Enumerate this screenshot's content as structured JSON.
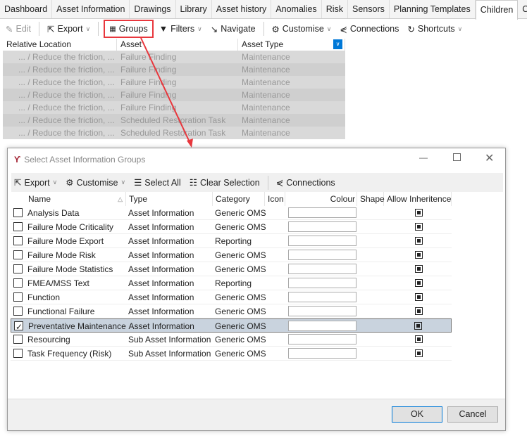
{
  "tabs": [
    "Dashboard",
    "Asset Information",
    "Drawings",
    "Library",
    "Asset history",
    "Anomalies",
    "Risk",
    "Sensors",
    "Planning Templates",
    "Children",
    "Charts"
  ],
  "active_tab": "Children",
  "toolbar": {
    "edit": "Edit",
    "export": "Export",
    "groups": "Groups",
    "filters": "Filters",
    "navigate": "Navigate",
    "customise": "Customise",
    "connections": "Connections",
    "shortcuts": "Shortcuts"
  },
  "grid": {
    "columns": [
      "Relative Location",
      "Asset",
      "Asset Type"
    ],
    "rows": [
      [
        "... / Reduce the friction, ...",
        "Failure Finding",
        "Maintenance"
      ],
      [
        "... / Reduce the friction, ...",
        "Failure Finding",
        "Maintenance"
      ],
      [
        "... / Reduce the friction, ...",
        "Failure Finding",
        "Maintenance"
      ],
      [
        "... / Reduce the friction, ...",
        "Failure Finding",
        "Maintenance"
      ],
      [
        "... / Reduce the friction, ...",
        "Failure Finding",
        "Maintenance"
      ],
      [
        "... / Reduce the friction, ...",
        "Scheduled Restoration Task",
        "Maintenance"
      ],
      [
        "... / Reduce the friction, ...",
        "Scheduled Restoration Task",
        "Maintenance"
      ]
    ]
  },
  "dialog": {
    "title": "Select Asset Information Groups",
    "toolbar": {
      "export": "Export",
      "customise": "Customise",
      "select_all": "Select All",
      "clear_selection": "Clear Selection",
      "connections": "Connections"
    },
    "columns": [
      "Name",
      "Type",
      "Category",
      "Icon",
      "Colour",
      "Shape",
      "Allow Inheritence"
    ],
    "rows": [
      {
        "name": "Analysis Data",
        "type": "Asset Information",
        "category": "Generic OMS",
        "checked": false
      },
      {
        "name": "Failure Mode Criticality",
        "type": "Asset Information",
        "category": "Generic OMS",
        "checked": false
      },
      {
        "name": "Failure Mode Export",
        "type": "Asset Information",
        "category": "Reporting",
        "checked": false
      },
      {
        "name": "Failure Mode Risk",
        "type": "Asset Information",
        "category": "Generic OMS",
        "checked": false
      },
      {
        "name": "Failure Mode Statistics",
        "type": "Asset Information",
        "category": "Generic OMS",
        "checked": false
      },
      {
        "name": "FMEA/MSS Text",
        "type": "Asset Information",
        "category": "Reporting",
        "checked": false
      },
      {
        "name": "Function",
        "type": "Asset Information",
        "category": "Generic OMS",
        "checked": false
      },
      {
        "name": "Functional Failure",
        "type": "Asset Information",
        "category": "Generic OMS",
        "checked": false
      },
      {
        "name": "Preventative Maintenance",
        "type": "Asset Information",
        "category": "Generic OMS",
        "checked": true
      },
      {
        "name": "Resourcing",
        "type": "Sub Asset Information",
        "category": "Generic OMS",
        "checked": false
      },
      {
        "name": "Task Frequency (Risk)",
        "type": "Sub Asset Information",
        "category": "Generic OMS",
        "checked": false
      }
    ],
    "ok": "OK",
    "cancel": "Cancel"
  },
  "colors": {
    "highlight": "#e8373d",
    "selected_row": "#c9d3de",
    "accent": "#0078d7"
  }
}
